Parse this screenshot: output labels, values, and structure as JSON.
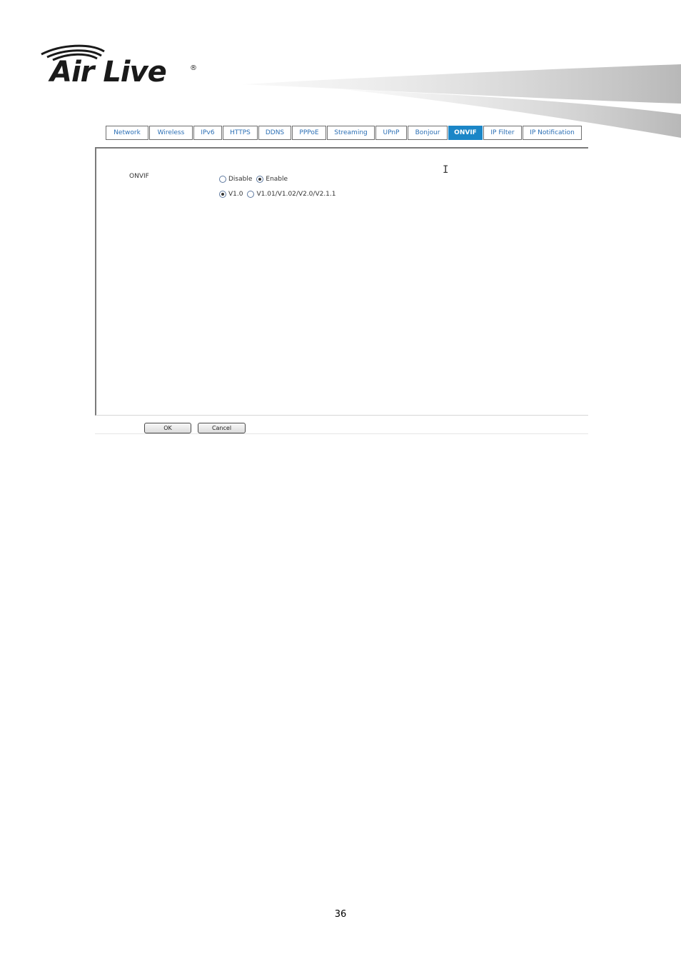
{
  "brand": {
    "logo_text": "Air Live",
    "registered_mark": "®"
  },
  "tabs": [
    {
      "label": "Network"
    },
    {
      "label": "Wireless"
    },
    {
      "label": "IPv6"
    },
    {
      "label": "HTTPS"
    },
    {
      "label": "DDNS"
    },
    {
      "label": "PPPoE"
    },
    {
      "label": "Streaming"
    },
    {
      "label": "UPnP"
    },
    {
      "label": "Bonjour"
    },
    {
      "label": "ONVIF",
      "active": true
    },
    {
      "label": "IP Filter"
    },
    {
      "label": "IP Notification"
    }
  ],
  "onvif": {
    "field_label": "ONVIF",
    "mode_options": [
      {
        "label": "Disable",
        "selected": false
      },
      {
        "label": "Enable",
        "selected": true
      }
    ],
    "version_options": [
      {
        "label": "V1.0",
        "selected": true
      },
      {
        "label": "V1.01/V1.02/V2.0/V2.1.1",
        "selected": false
      }
    ]
  },
  "buttons": {
    "ok_label": "OK",
    "cancel_label": "Cancel"
  },
  "page_number": "36",
  "colors": {
    "accent": "#1b86c7",
    "tab_text": "#2b6fb5"
  }
}
